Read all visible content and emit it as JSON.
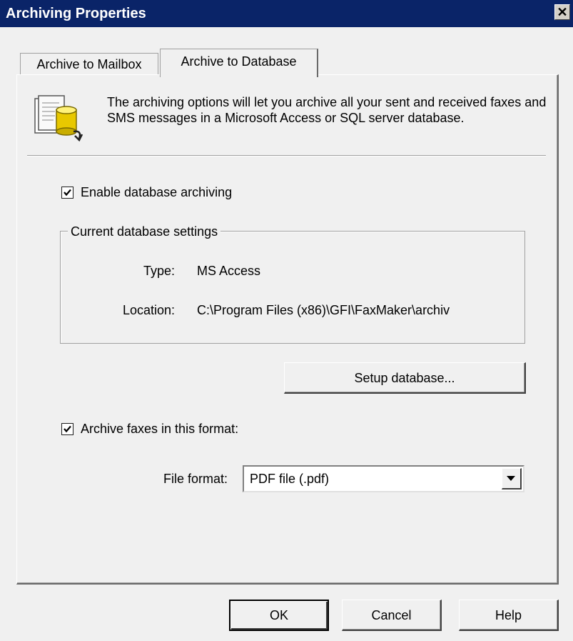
{
  "window": {
    "title": "Archiving Properties",
    "close_glyph": "✕"
  },
  "tabs": [
    {
      "label": "Archive to Mailbox",
      "active": false
    },
    {
      "label": "Archive to Database",
      "active": true
    }
  ],
  "panel": {
    "icon": "database-icon",
    "intro_text": "The archiving options will let you archive all your sent and received faxes and SMS messages in a Microsoft Access or SQL server database.",
    "enable_archiving": {
      "label": "Enable database archiving",
      "checked": true
    },
    "current_settings": {
      "legend": "Current database settings",
      "type_label": "Type:",
      "type_value": "MS Access",
      "location_label": "Location:",
      "location_value": "C:\\Program Files (x86)\\GFI\\FaxMaker\\archiv"
    },
    "setup_button": "Setup database...",
    "archive_format": {
      "label": "Archive faxes in this format:",
      "checked": true
    },
    "file_format": {
      "label": "File format:",
      "selected": "PDF file (.pdf)"
    }
  },
  "footer": {
    "ok": "OK",
    "cancel": "Cancel",
    "help": "Help"
  }
}
